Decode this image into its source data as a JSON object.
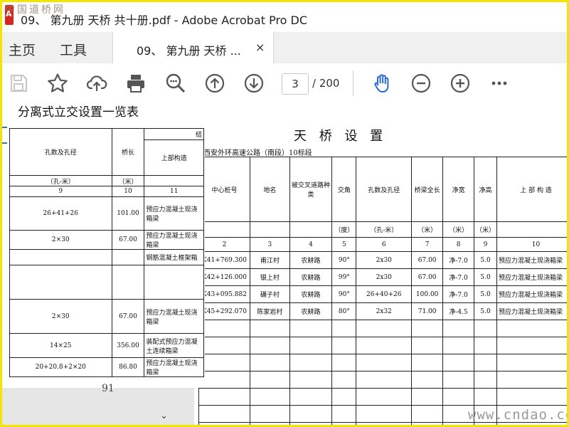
{
  "window": {
    "watermark": "中国道桥网",
    "title": "09、 第九册 天桥  共十册.pdf - Adobe Acrobat Pro DC"
  },
  "menu": {
    "home": "主页",
    "tools": "工具"
  },
  "tab": {
    "label": "09、 第九册 天桥  ...",
    "close": "×"
  },
  "toolbar": {
    "page_current": "3",
    "page_total": "/ 200"
  },
  "left_sheet": {
    "title": "分离式立交设置一览表",
    "header_top_right": "结",
    "col_headers": [
      "孔数及孔径",
      "桥长",
      "上部构造"
    ],
    "units": [
      "（孔-米）",
      "（米）",
      ""
    ],
    "col_numbers": [
      "9",
      "10",
      "11"
    ],
    "rows": [
      [
        "26+41+26",
        "101.00",
        "预应力混凝土现浇箱梁"
      ],
      [
        "2×30",
        "67.00",
        "预应力混凝土现浇箱梁"
      ],
      [
        "",
        "",
        "钢筋混凝土框架箱"
      ],
      [
        "",
        "",
        ""
      ],
      [
        "2×30",
        "67.00",
        "预应力混凝土现浇箱梁"
      ],
      [
        "14×25",
        "356.00",
        "装配式预应力混凝土连续箱梁"
      ],
      [
        "20+20.8+2×20",
        "86.80",
        "预应力混凝土现浇箱梁"
      ]
    ],
    "page_number": "91"
  },
  "main_sheet": {
    "title": "天 桥 设 置",
    "subtitle": "西安外环高速公路（南段）10标段",
    "col_headers": [
      "中心桩号",
      "地名",
      "被交叉道路种类",
      "交角",
      "孔数及孔径",
      "桥梁全长",
      "净宽",
      "净高",
      "上 部 构 造"
    ],
    "units": [
      "",
      "",
      "",
      "（度）",
      "（孔-米）",
      "（米）",
      "（米）",
      "（米）",
      ""
    ],
    "col_numbers": [
      "2",
      "3",
      "4",
      "5",
      "6",
      "7",
      "8",
      "9",
      "10"
    ],
    "rows": [
      [
        "K41+769.300",
        "甫江村",
        "农耕路",
        "90°",
        "2x30",
        "67.00",
        "净-7.0",
        "5.0",
        "预应力混凝土现浇箱梁"
      ],
      [
        "K42+126.000",
        "银上村",
        "农耕路",
        "99°",
        "2x30",
        "67.00",
        "净-7.0",
        "5.0",
        "预应力混凝土现浇箱梁"
      ],
      [
        "K43+095.882",
        "碾子村",
        "农耕路",
        "90°",
        "26+40+26",
        "100.00",
        "净-7.0",
        "5.0",
        "预应力混凝土现浇箱梁"
      ],
      [
        "K45+292.070",
        "陈家岩村",
        "农耕路",
        "80°",
        "2x32",
        "71.00",
        "净-4.5",
        "5.0",
        "预应力混凝土现浇箱梁"
      ]
    ]
  },
  "watermark_bottom": "www.cndao.com",
  "colors": {
    "accent": "#2a6bd6",
    "frame": "#f2e600",
    "logo": "#d6261e"
  }
}
